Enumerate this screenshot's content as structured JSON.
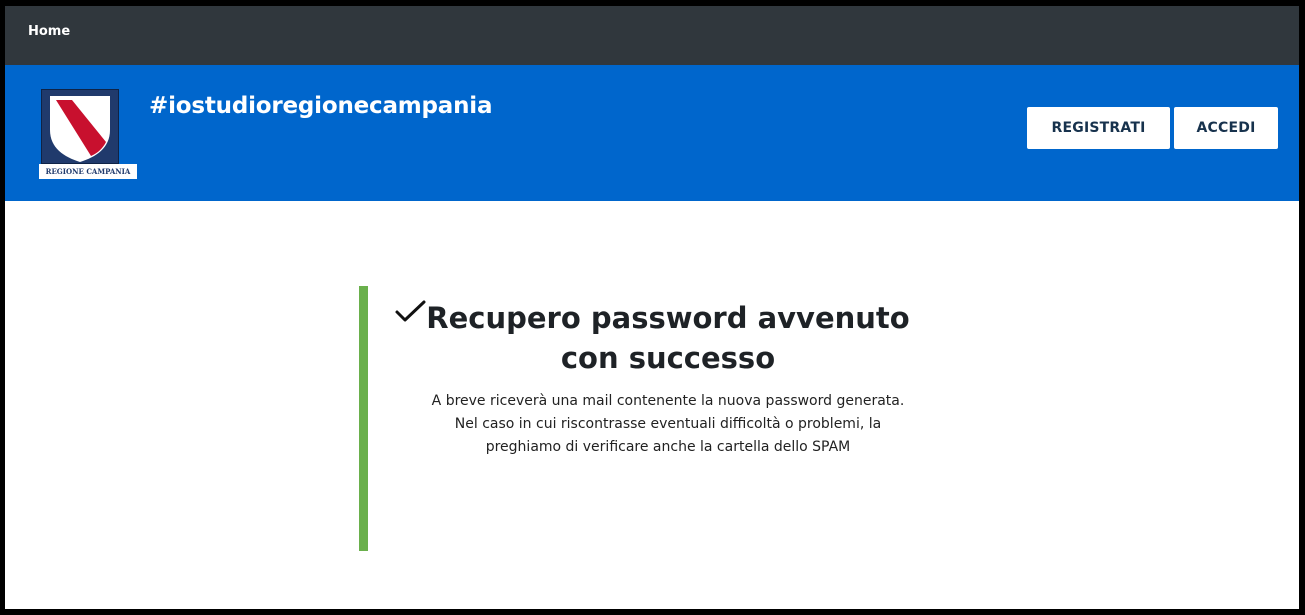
{
  "topbar": {
    "home_link": "Home"
  },
  "header": {
    "logo_caption": "REGIONE CAMPANIA",
    "site_title": "#iostudioregionecampania",
    "register_label": "REGISTRATI",
    "login_label": "ACCEDI"
  },
  "alert": {
    "icon": "check-icon",
    "accent_color": "#6ab04c",
    "title": "Recupero password avvenuto con successo",
    "message_line1": "A breve riceverà una mail contenente la nuova password generata.",
    "message_line2": "Nel caso in cui riscontrasse eventuali difficoltà o problemi, la preghiamo di verificare anche la cartella dello SPAM"
  },
  "colors": {
    "topbar_bg": "#30373d",
    "header_bg": "#0066cc",
    "button_text": "#17324d"
  }
}
